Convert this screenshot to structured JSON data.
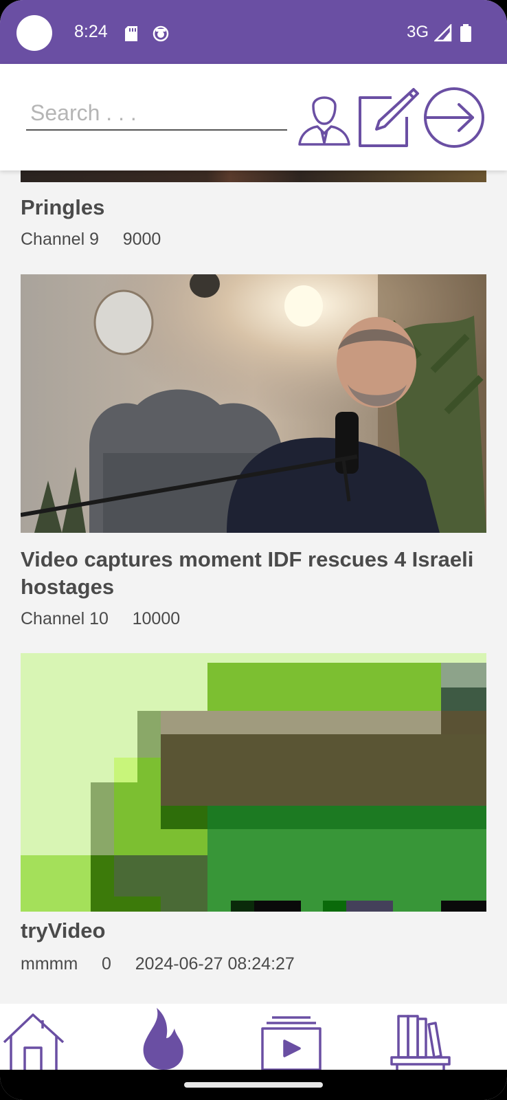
{
  "status_bar": {
    "time": "8:24",
    "network": "3G",
    "icons": [
      "sd-card-icon",
      "face-notification-icon",
      "signal-icon",
      "battery-icon"
    ]
  },
  "header": {
    "search_placeholder": "Search . . .",
    "search_value": "",
    "icons": [
      "user-icon",
      "edit-icon",
      "logout-icon"
    ]
  },
  "videos": [
    {
      "title": "Pringles",
      "channel": "Channel 9",
      "views": "9000",
      "date": ""
    },
    {
      "title": "Video captures moment IDF rescues 4 Israeli hostages",
      "channel": "Channel 10",
      "views": "10000",
      "date": ""
    },
    {
      "title": "tryVideo",
      "channel": "mmmm",
      "views": "0",
      "date": "2024-06-27 08:24:27"
    }
  ],
  "bottom_nav": {
    "items": [
      "home-icon",
      "trending-icon",
      "subscriptions-icon",
      "library-icon"
    ]
  },
  "colors": {
    "accent": "#6a4fa3",
    "background": "#f3f3f3",
    "text": "#4a4a4a"
  }
}
